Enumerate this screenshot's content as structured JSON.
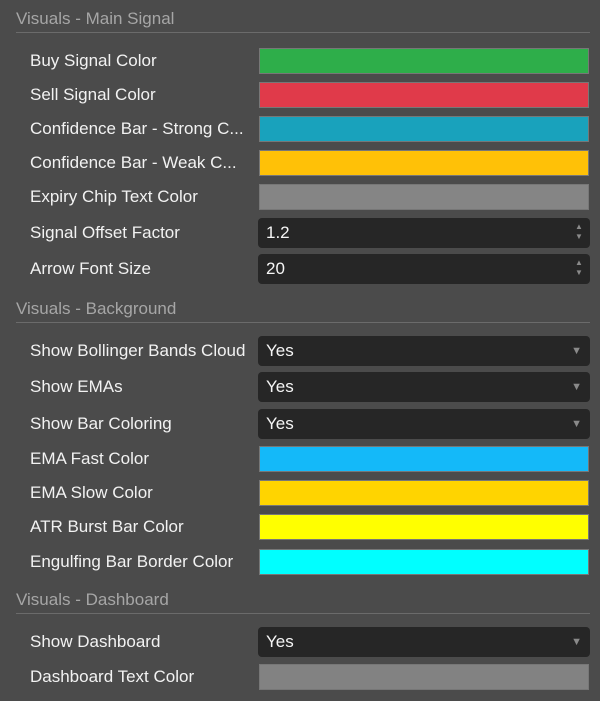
{
  "sections": {
    "main_signal": {
      "title": "Visuals - Main Signal",
      "buy_signal_color": {
        "label": "Buy Signal Color",
        "color": "#2eae4a"
      },
      "sell_signal_color": {
        "label": "Sell Signal Color",
        "color": "#e03a4a"
      },
      "confidence_strong": {
        "label": "Confidence Bar - Strong C...",
        "color": "#19a2bc"
      },
      "confidence_weak": {
        "label": "Confidence Bar - Weak C...",
        "color": "#ffc107"
      },
      "expiry_chip_text": {
        "label": "Expiry Chip Text Color",
        "color": "#858585"
      },
      "signal_offset": {
        "label": "Signal Offset Factor",
        "value": "1.2"
      },
      "arrow_font_size": {
        "label": "Arrow Font Size",
        "value": "20"
      }
    },
    "background": {
      "title": "Visuals - Background",
      "show_bb_cloud": {
        "label": "Show Bollinger Bands Cloud",
        "value": "Yes"
      },
      "show_emas": {
        "label": "Show EMAs",
        "value": "Yes"
      },
      "show_bar_coloring": {
        "label": "Show Bar Coloring",
        "value": "Yes"
      },
      "ema_fast_color": {
        "label": "EMA Fast Color",
        "color": "#14b9f9"
      },
      "ema_slow_color": {
        "label": "EMA Slow Color",
        "color": "#ffd400"
      },
      "atr_burst_color": {
        "label": "ATR Burst Bar Color",
        "color": "#ffff00"
      },
      "engulfing_border_color": {
        "label": "Engulfing Bar Border Color",
        "color": "#00ffff"
      }
    },
    "dashboard": {
      "title": "Visuals - Dashboard",
      "show_dashboard": {
        "label": "Show Dashboard",
        "value": "Yes"
      },
      "dashboard_text_color": {
        "label": "Dashboard Text Color",
        "color": "#828282"
      }
    }
  },
  "icons": {
    "spin_up": "▲",
    "spin_down": "▼",
    "select_caret": "▼"
  }
}
